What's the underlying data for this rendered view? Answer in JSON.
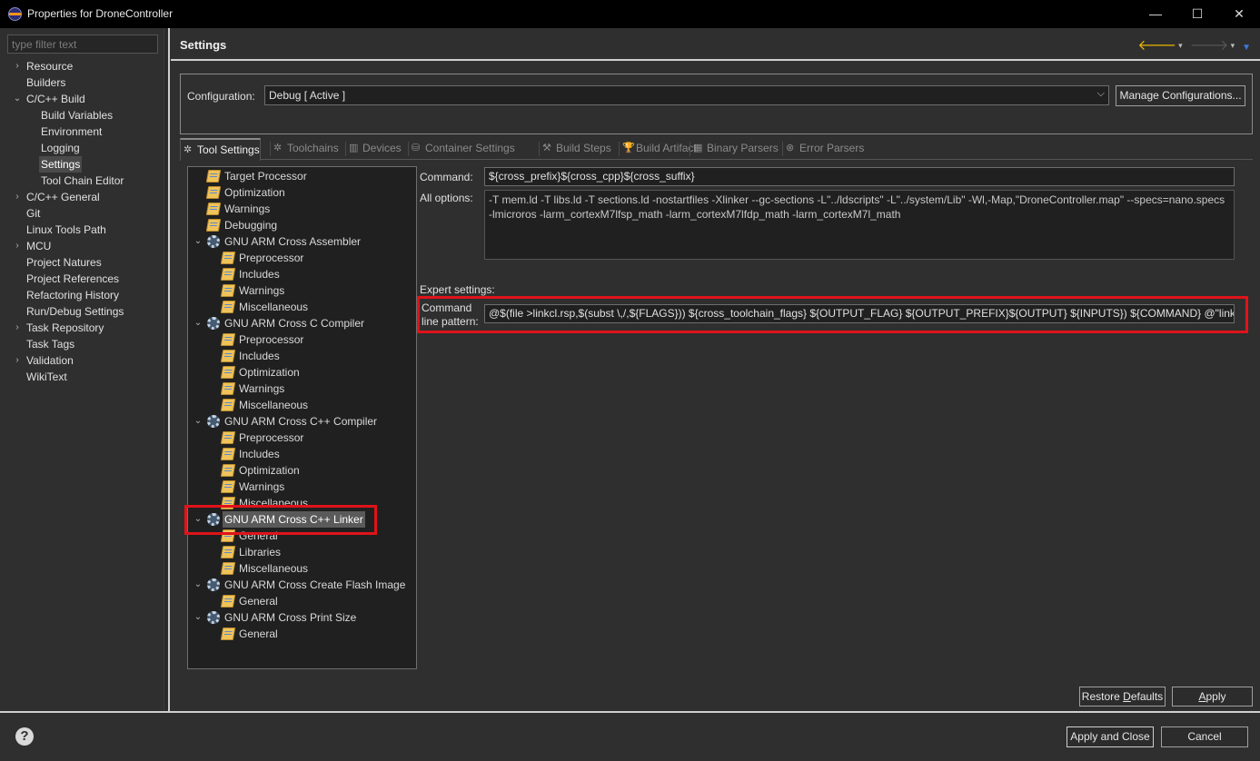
{
  "window": {
    "title": "Properties for DroneController",
    "min_glyph": "—",
    "max_glyph": "☐",
    "close_glyph": "✕"
  },
  "filter": {
    "placeholder": "type filter text"
  },
  "nav": {
    "items": [
      {
        "label": "Resource",
        "toggle": "›",
        "level": 0
      },
      {
        "label": "Builders",
        "toggle": "",
        "level": 0
      },
      {
        "label": "C/C++ Build",
        "toggle": "⌄",
        "level": 0
      },
      {
        "label": "Build Variables",
        "toggle": "",
        "level": 1
      },
      {
        "label": "Environment",
        "toggle": "",
        "level": 1
      },
      {
        "label": "Logging",
        "toggle": "",
        "level": 1
      },
      {
        "label": "Settings",
        "toggle": "",
        "level": 1,
        "selected": true
      },
      {
        "label": "Tool Chain Editor",
        "toggle": "",
        "level": 1
      },
      {
        "label": "C/C++ General",
        "toggle": "›",
        "level": 0
      },
      {
        "label": "Git",
        "toggle": "",
        "level": 0
      },
      {
        "label": "Linux Tools Path",
        "toggle": "",
        "level": 0
      },
      {
        "label": "MCU",
        "toggle": "›",
        "level": 0
      },
      {
        "label": "Project Natures",
        "toggle": "",
        "level": 0
      },
      {
        "label": "Project References",
        "toggle": "",
        "level": 0
      },
      {
        "label": "Refactoring History",
        "toggle": "",
        "level": 0
      },
      {
        "label": "Run/Debug Settings",
        "toggle": "",
        "level": 0
      },
      {
        "label": "Task Repository",
        "toggle": "›",
        "level": 0
      },
      {
        "label": "Task Tags",
        "toggle": "",
        "level": 0
      },
      {
        "label": "Validation",
        "toggle": "›",
        "level": 0
      },
      {
        "label": "WikiText",
        "toggle": "",
        "level": 0
      }
    ]
  },
  "header": {
    "title": "Settings",
    "back_icon": "arrow-left-icon",
    "forward_icon": "arrow-right-icon",
    "dropdown_glyph": "▾",
    "menu_glyph": "▼"
  },
  "configuration": {
    "label": "Configuration:",
    "value": "Debug  [ Active ]",
    "manage_label": "Manage Configurations...",
    "chevron": "⌵"
  },
  "tabs": [
    {
      "label": "Tool Settings",
      "icon": "✲",
      "active": true
    },
    {
      "label": "Toolchains",
      "icon": "✲"
    },
    {
      "label": "Devices",
      "icon": "▥"
    },
    {
      "label": "Container Settings",
      "icon": "⛁"
    },
    {
      "label": "Build Steps",
      "icon": "⚒"
    },
    {
      "label": "Build Artifact",
      "icon": "🏆"
    },
    {
      "label": "Binary Parsers",
      "icon": "▦"
    },
    {
      "label": "Error Parsers",
      "icon": "⊗"
    }
  ],
  "tool_tree": [
    {
      "label": "Target Processor",
      "type": "option",
      "depth": 1
    },
    {
      "label": "Optimization",
      "type": "option",
      "depth": 1
    },
    {
      "label": "Warnings",
      "type": "option",
      "depth": 1
    },
    {
      "label": "Debugging",
      "type": "option",
      "depth": 1
    },
    {
      "label": "GNU ARM Cross Assembler",
      "type": "tool",
      "depth": 1
    },
    {
      "label": "Preprocessor",
      "type": "option",
      "depth": 2
    },
    {
      "label": "Includes",
      "type": "option",
      "depth": 2
    },
    {
      "label": "Warnings",
      "type": "option",
      "depth": 2
    },
    {
      "label": "Miscellaneous",
      "type": "option",
      "depth": 2
    },
    {
      "label": "GNU ARM Cross C Compiler",
      "type": "tool",
      "depth": 1
    },
    {
      "label": "Preprocessor",
      "type": "option",
      "depth": 2
    },
    {
      "label": "Includes",
      "type": "option",
      "depth": 2
    },
    {
      "label": "Optimization",
      "type": "option",
      "depth": 2
    },
    {
      "label": "Warnings",
      "type": "option",
      "depth": 2
    },
    {
      "label": "Miscellaneous",
      "type": "option",
      "depth": 2
    },
    {
      "label": "GNU ARM Cross C++ Compiler",
      "type": "tool",
      "depth": 1
    },
    {
      "label": "Preprocessor",
      "type": "option",
      "depth": 2
    },
    {
      "label": "Includes",
      "type": "option",
      "depth": 2
    },
    {
      "label": "Optimization",
      "type": "option",
      "depth": 2
    },
    {
      "label": "Warnings",
      "type": "option",
      "depth": 2
    },
    {
      "label": "Miscellaneous",
      "type": "option",
      "depth": 2
    },
    {
      "label": "GNU ARM Cross C++ Linker",
      "type": "tool",
      "depth": 1,
      "selected": true
    },
    {
      "label": "General",
      "type": "option",
      "depth": 2
    },
    {
      "label": "Libraries",
      "type": "option",
      "depth": 2
    },
    {
      "label": "Miscellaneous",
      "type": "option",
      "depth": 2
    },
    {
      "label": "GNU ARM Cross Create Flash Image",
      "type": "tool",
      "depth": 1
    },
    {
      "label": "General",
      "type": "option",
      "depth": 2
    },
    {
      "label": "GNU ARM Cross Print Size",
      "type": "tool",
      "depth": 1
    },
    {
      "label": "General",
      "type": "option",
      "depth": 2
    }
  ],
  "linker": {
    "command_label": "Command:",
    "command_value": "${cross_prefix}${cross_cpp}${cross_suffix}",
    "all_options_label": "All options:",
    "all_options_value": "-T mem.ld -T libs.ld -T sections.ld -nostartfiles -Xlinker --gc-sections -L\"../ldscripts\" -L\"../system/Lib\" -Wl,-Map,\"DroneController.map\" --specs=nano.specs -lmicroros -larm_cortexM7lfsp_math -larm_cortexM7lfdp_math -larm_cortexM7l_math",
    "expert_label": "Expert settings:",
    "pattern_label_1": "Command",
    "pattern_label_2": "line pattern:",
    "pattern_value": "@$(file >linkcl.rsp,$(subst \\,/,${FLAGS})) ${cross_toolchain_flags} ${OUTPUT_FLAG} ${OUTPUT_PREFIX}${OUTPUT} ${INPUTS}) ${COMMAND} @\"linkcl.rsp\""
  },
  "buttons": {
    "restore_pre": "Restore ",
    "restore_u": "D",
    "restore_post": "efaults",
    "apply_u": "A",
    "apply_post": "pply",
    "apply_close": "Apply and Close",
    "cancel": "Cancel",
    "help": "?"
  },
  "colors": {
    "highlight_box": "#e0131a",
    "back_arrow": "#e8b400"
  }
}
